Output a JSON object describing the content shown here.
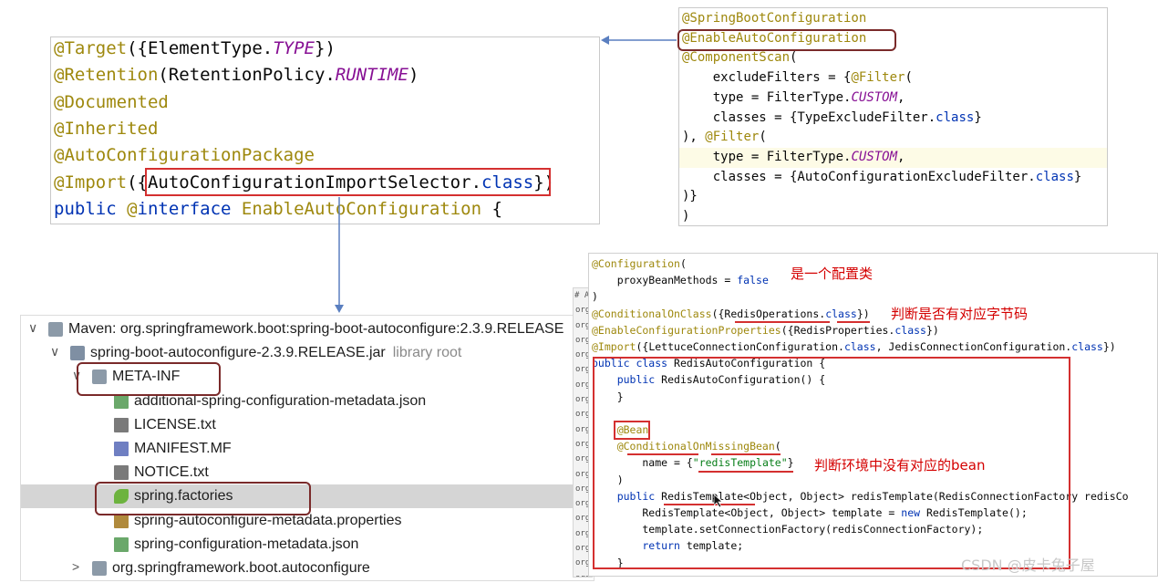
{
  "panel_a": {
    "lines": [
      {
        "segments": [
          [
            "anno",
            "@Target"
          ],
          [
            "plain",
            "({ElementType."
          ],
          [
            "ital",
            "TYPE"
          ],
          [
            "plain",
            "})"
          ]
        ]
      },
      {
        "segments": [
          [
            "anno",
            "@Retention"
          ],
          [
            "plain",
            "(RetentionPolicy."
          ],
          [
            "ital",
            "RUNTIME"
          ],
          [
            "plain",
            ")"
          ]
        ]
      },
      {
        "segments": [
          [
            "anno",
            "@Documented"
          ]
        ]
      },
      {
        "segments": [
          [
            "anno",
            "@Inherited"
          ]
        ]
      },
      {
        "segments": [
          [
            "anno",
            "@AutoConfigurationPackage"
          ]
        ]
      },
      {
        "segments": [
          [
            "anno",
            "@Import"
          ],
          [
            "plain",
            "({AutoConfigurationImportSelector."
          ],
          [
            "kw",
            "class"
          ],
          [
            "plain",
            "})"
          ]
        ]
      },
      {
        "segments": [
          [
            "kw",
            "public "
          ],
          [
            "anno",
            "@"
          ],
          [
            "kw",
            "interface "
          ],
          [
            "anno",
            "EnableAutoConfiguration"
          ],
          [
            "plain",
            " {"
          ]
        ]
      }
    ]
  },
  "panel_b": {
    "lines": [
      {
        "segments": [
          [
            "anno",
            "@SpringBootConfiguration"
          ]
        ]
      },
      {
        "segments": [
          [
            "anno",
            "@EnableAutoConfiguration"
          ]
        ]
      },
      {
        "segments": [
          [
            "anno",
            "@ComponentScan"
          ],
          [
            "plain",
            "("
          ]
        ]
      },
      {
        "segments": [
          [
            "plain",
            "    excludeFilters = {"
          ],
          [
            "anno",
            "@Filter"
          ],
          [
            "plain",
            "("
          ]
        ]
      },
      {
        "segments": [
          [
            "plain",
            "    type = FilterType."
          ],
          [
            "ital",
            "CUSTOM"
          ],
          [
            "plain",
            ","
          ]
        ]
      },
      {
        "segments": [
          [
            "plain",
            "    classes = {TypeExcludeFilter."
          ],
          [
            "kw",
            "class"
          ],
          [
            "plain",
            "}"
          ]
        ]
      },
      {
        "segments": [
          [
            "plain",
            "), "
          ],
          [
            "anno",
            "@Filter"
          ],
          [
            "plain",
            "("
          ]
        ]
      },
      {
        "segments": [
          [
            "plain",
            "    type = FilterType."
          ],
          [
            "ital",
            "CUSTOM"
          ],
          [
            "plain",
            ","
          ]
        ]
      },
      {
        "segments": [
          [
            "plain",
            "    classes = {AutoConfigurationExcludeFilter."
          ],
          [
            "kw",
            "class"
          ],
          [
            "plain",
            "}"
          ]
        ]
      },
      {
        "segments": [
          [
            "plain",
            ")}"
          ]
        ]
      },
      {
        "segments": [
          [
            "plain",
            ")"
          ]
        ]
      }
    ]
  },
  "panel_c": {
    "lines": [
      {
        "segments": [
          [
            "anno",
            "@Configuration"
          ],
          [
            "plain",
            "("
          ]
        ]
      },
      {
        "segments": [
          [
            "plain",
            "    proxyBeanMethods = "
          ],
          [
            "kw",
            "false"
          ]
        ]
      },
      {
        "segments": [
          [
            "plain",
            ")"
          ]
        ]
      },
      {
        "segments": [
          [
            "anno",
            "@ConditionalOnClass"
          ],
          [
            "plain",
            "({RedisOperations."
          ],
          [
            "kw",
            "class"
          ],
          [
            "plain",
            "})"
          ]
        ]
      },
      {
        "segments": [
          [
            "anno",
            "@EnableConfigurationProperties"
          ],
          [
            "plain",
            "({RedisProperties."
          ],
          [
            "kw",
            "class"
          ],
          [
            "plain",
            "})"
          ]
        ]
      },
      {
        "segments": [
          [
            "anno",
            "@Import"
          ],
          [
            "plain",
            "({LettuceConnectionConfiguration."
          ],
          [
            "kw",
            "class"
          ],
          [
            "plain",
            ", JedisConnectionConfiguration."
          ],
          [
            "kw",
            "class"
          ],
          [
            "plain",
            "})"
          ]
        ]
      },
      {
        "segments": [
          [
            "kw",
            "public class "
          ],
          [
            "plain",
            "RedisAutoConfiguration {"
          ]
        ]
      },
      {
        "segments": [
          [
            "kw",
            "    public "
          ],
          [
            "plain",
            "RedisAutoConfiguration() {"
          ]
        ]
      },
      {
        "segments": [
          [
            "plain",
            "    }"
          ]
        ]
      },
      {
        "segments": [
          [
            "plain",
            ""
          ]
        ]
      },
      {
        "segments": [
          [
            "anno",
            "    @Bean"
          ]
        ]
      },
      {
        "segments": [
          [
            "anno",
            "    @ConditionalOnMissingBean"
          ],
          [
            "plain",
            "("
          ]
        ]
      },
      {
        "segments": [
          [
            "plain",
            "        name = {"
          ],
          [
            "str",
            "\"redisTemplate\""
          ],
          [
            "plain",
            "}"
          ]
        ]
      },
      {
        "segments": [
          [
            "plain",
            "    )"
          ]
        ]
      },
      {
        "segments": [
          [
            "kw",
            "    public "
          ],
          [
            "plain",
            "RedisTemplate<Object, Object> redisTemplate(RedisConnectionFactory redisCo"
          ]
        ]
      },
      {
        "segments": [
          [
            "plain",
            "        RedisTemplate<Object, Object> template = "
          ],
          [
            "kw",
            "new "
          ],
          [
            "plain",
            "RedisTemplate();"
          ]
        ]
      },
      {
        "segments": [
          [
            "plain",
            "        template.setConnectionFactory(redisConnectionFactory);"
          ]
        ]
      },
      {
        "segments": [
          [
            "kw",
            "        return "
          ],
          [
            "plain",
            "template;"
          ]
        ]
      },
      {
        "segments": [
          [
            "plain",
            "    }"
          ]
        ]
      }
    ],
    "notes": {
      "config_class": "是一个配置类",
      "has_bytecode": "判断是否有对应字节码",
      "no_bean": "判断环境中没有对应的bean"
    }
  },
  "gutter": {
    "header": "# A",
    "rows": [
      "org",
      "org",
      "org",
      "org",
      "org",
      "org",
      "org",
      "org",
      "org",
      "org",
      "org",
      "org",
      "org",
      "org",
      "org",
      "org",
      "org",
      "org",
      "org"
    ]
  },
  "tree": {
    "rows": [
      {
        "indent": 0,
        "chevron": "∨",
        "icon": "library",
        "label": "Maven: org.springframework.boot:spring-boot-autoconfigure:2.3.9.RELEASE"
      },
      {
        "indent": 1,
        "chevron": "∨",
        "icon": "jar",
        "label": "spring-boot-autoconfigure-2.3.9.RELEASE.jar",
        "hint": "library root"
      },
      {
        "indent": 2,
        "chevron": "∨",
        "icon": "folder",
        "label": "META-INF"
      },
      {
        "indent": 3,
        "chevron": "",
        "icon": "json",
        "label": "additional-spring-configuration-metadata.json"
      },
      {
        "indent": 3,
        "chevron": "",
        "icon": "text",
        "label": "LICENSE.txt"
      },
      {
        "indent": 3,
        "chevron": "",
        "icon": "mf",
        "label": "MANIFEST.MF"
      },
      {
        "indent": 3,
        "chevron": "",
        "icon": "text",
        "label": "NOTICE.txt"
      },
      {
        "indent": 3,
        "chevron": "",
        "icon": "spring",
        "label": "spring.factories",
        "selected": true
      },
      {
        "indent": 3,
        "chevron": "",
        "icon": "props",
        "label": "spring-autoconfigure-metadata.properties"
      },
      {
        "indent": 3,
        "chevron": "",
        "icon": "json",
        "label": "spring-configuration-metadata.json"
      },
      {
        "indent": 2,
        "chevron": ">",
        "icon": "folder",
        "label": "org.springframework.boot.autoconfigure"
      }
    ]
  },
  "watermark": "CSDN @皮卡兔子屋",
  "colors": {
    "annotation": "#9e880d",
    "keyword": "#0033b3",
    "static_field": "#871094",
    "string": "#067d17",
    "highlight": "#d43030"
  }
}
